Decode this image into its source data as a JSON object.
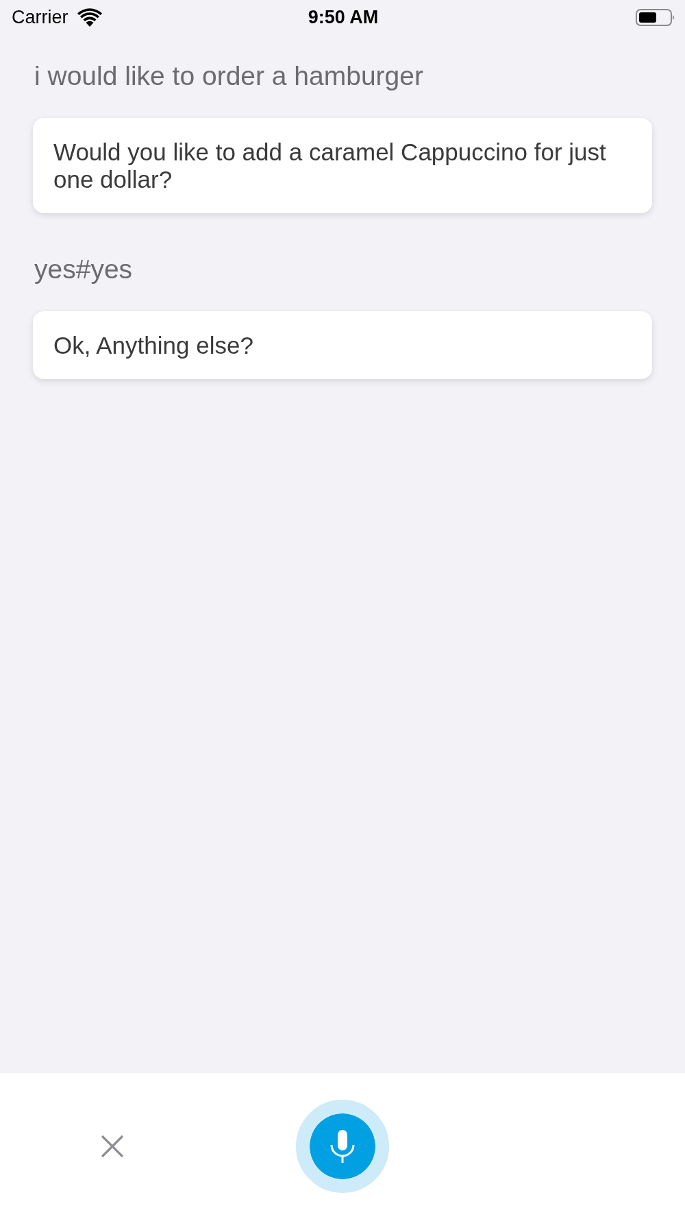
{
  "status_bar": {
    "carrier": "Carrier",
    "time": "9:50 AM"
  },
  "messages": [
    {
      "kind": "user",
      "text": "i would like to order a hamburger"
    },
    {
      "kind": "bot",
      "text": "Would you like to add a caramel Cappuccino for just one dollar?"
    },
    {
      "kind": "user",
      "text": "yes#yes"
    },
    {
      "kind": "bot",
      "text": "Ok, Anything else?"
    }
  ],
  "controls": {
    "microphone": {
      "active": true
    }
  }
}
